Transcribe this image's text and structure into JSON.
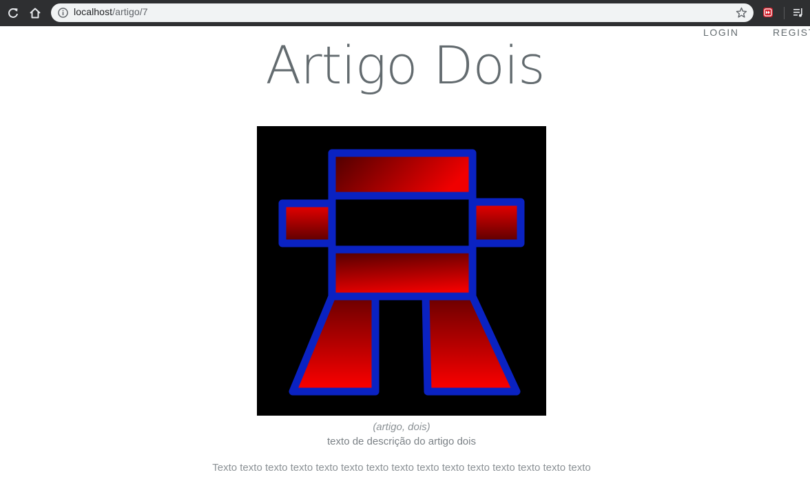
{
  "browser": {
    "url_host": "localhost",
    "url_path": "/artigo/7"
  },
  "nav": {
    "login": "LOGIN",
    "register": "REGIST"
  },
  "article": {
    "title": "Artigo Dois",
    "tags": "(artigo, dois)",
    "description": "texto de descrição do artigo dois",
    "body": "Texto texto texto texto texto texto texto texto texto texto texto texto texto texto texto"
  },
  "colors": {
    "outline": "#0a22c2",
    "fill_bright": "#ee0000",
    "fill_dark": "#5a0000",
    "text_gray": "#636b6f"
  }
}
